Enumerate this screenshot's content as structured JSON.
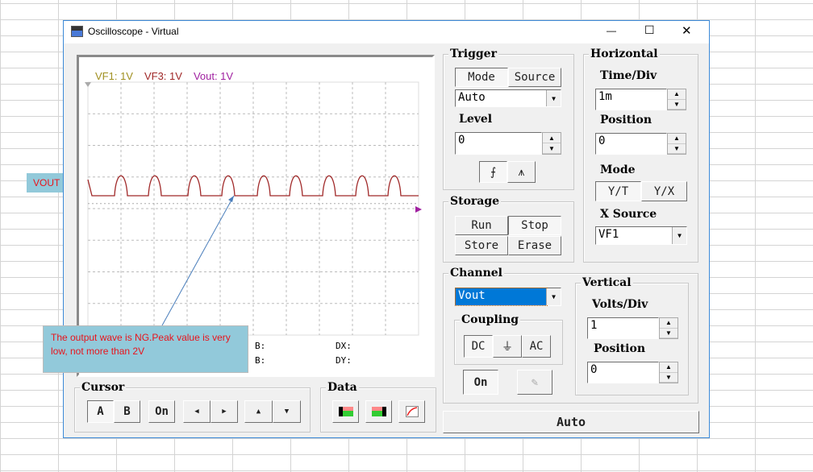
{
  "window": {
    "title": "Oscilloscope - Virtual",
    "minimize": "—",
    "maximize": "☐",
    "close": "✕"
  },
  "screen": {
    "channel_labels": [
      {
        "text": "VF1: 1V",
        "color": "#a09020"
      },
      {
        "text": "VF3: 1V",
        "color": "#a02828"
      },
      {
        "text": "Vout: 1V",
        "color": "#a020a0"
      }
    ],
    "trace_color": "#a02828",
    "readouts": {
      "b": "B:",
      "dx": "DX:",
      "ab": "B:",
      "dy": "DY:"
    }
  },
  "annotations": {
    "vout_label": "VOUT",
    "callout": "The output wave is NG.Peak value is very low, not more than 2V",
    "callout_bg": "#92c9da",
    "callout_color": "#e8141c"
  },
  "trigger": {
    "title": "Trigger",
    "mode": "Mode",
    "source": "Source",
    "mode_value": "Auto",
    "level_label": "Level",
    "level_value": "0",
    "rising": "rising-edge-icon",
    "falling": "falling-edge-icon"
  },
  "horizontal": {
    "title": "Horizontal",
    "time_div_label": "Time/Div",
    "time_div_value": "1m",
    "position_label": "Position",
    "position_value": "0",
    "mode_label": "Mode",
    "yt": "Y/T",
    "yx": "Y/X",
    "xsource_label": "X Source",
    "xsource_value": "VF1"
  },
  "storage": {
    "title": "Storage",
    "run": "Run",
    "stop": "Stop",
    "store": "Store",
    "erase": "Erase"
  },
  "channel": {
    "title": "Channel",
    "selected": "Vout",
    "coupling_title": "Coupling",
    "dc": "DC",
    "gnd": "⏚",
    "ac": "AC",
    "on": "On"
  },
  "vertical": {
    "title": "Vertical",
    "volts_div_label": "Volts/Div",
    "volts_div_value": "1",
    "position_label": "Position",
    "position_value": "0"
  },
  "cursor": {
    "title": "Cursor",
    "a": "A",
    "b": "B",
    "on": "On",
    "left": "◀",
    "right": "▶",
    "up": "▲",
    "down": "▼"
  },
  "data": {
    "title": "Data"
  },
  "auto": "Auto"
}
